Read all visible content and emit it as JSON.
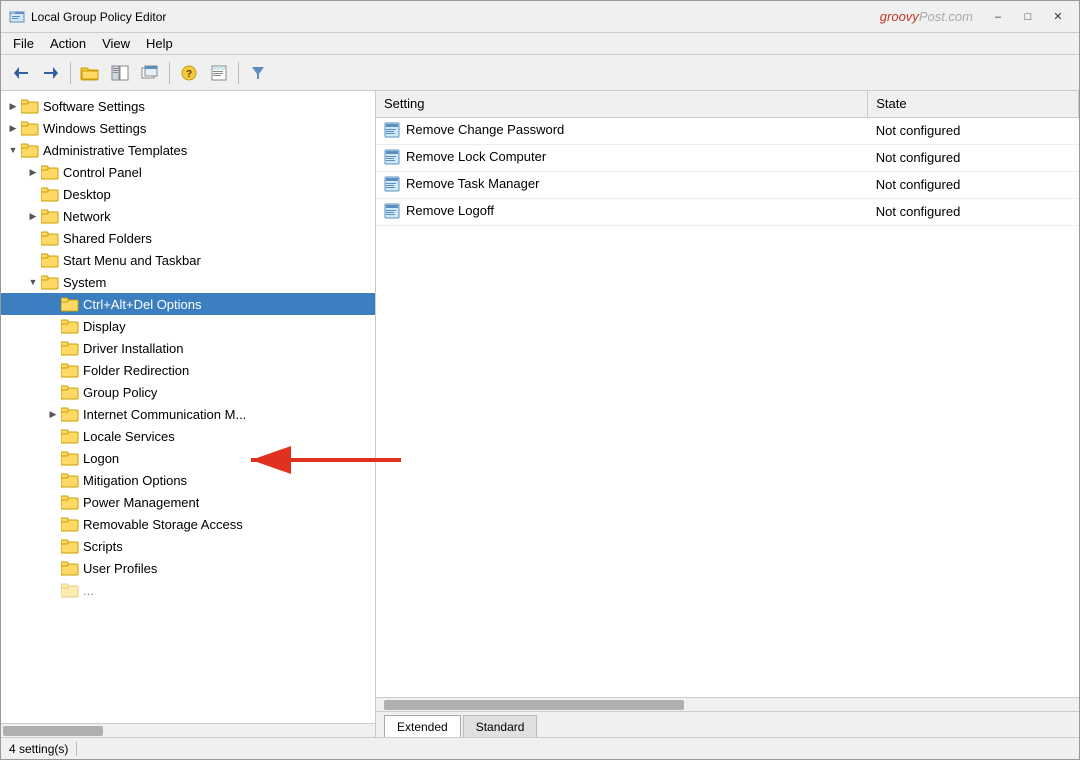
{
  "window": {
    "title": "Local Group Policy Editor",
    "watermark": "groovyPost.com"
  },
  "menubar": {
    "items": [
      "File",
      "Action",
      "View",
      "Help"
    ]
  },
  "toolbar": {
    "buttons": [
      {
        "name": "back",
        "icon": "◀"
      },
      {
        "name": "forward",
        "icon": "▶"
      },
      {
        "name": "up",
        "icon": "📁"
      },
      {
        "name": "show-hide",
        "icon": "📋"
      },
      {
        "name": "new-window",
        "icon": "🗗"
      },
      {
        "name": "help",
        "icon": "?"
      },
      {
        "name": "export",
        "icon": "📤"
      },
      {
        "name": "filter",
        "icon": "⬦"
      }
    ]
  },
  "tree": {
    "nodes": [
      {
        "id": "software-settings",
        "label": "Software Settings",
        "level": 0,
        "expanded": false,
        "hasChildren": true
      },
      {
        "id": "windows-settings",
        "label": "Windows Settings",
        "level": 0,
        "expanded": false,
        "hasChildren": true
      },
      {
        "id": "admin-templates",
        "label": "Administrative Templates",
        "level": 0,
        "expanded": true,
        "hasChildren": true
      },
      {
        "id": "control-panel",
        "label": "Control Panel",
        "level": 1,
        "expanded": false,
        "hasChildren": true
      },
      {
        "id": "desktop",
        "label": "Desktop",
        "level": 1,
        "expanded": false,
        "hasChildren": false
      },
      {
        "id": "network",
        "label": "Network",
        "level": 1,
        "expanded": false,
        "hasChildren": true
      },
      {
        "id": "shared-folders",
        "label": "Shared Folders",
        "level": 1,
        "expanded": false,
        "hasChildren": false
      },
      {
        "id": "start-menu",
        "label": "Start Menu and Taskbar",
        "level": 1,
        "expanded": false,
        "hasChildren": false
      },
      {
        "id": "system",
        "label": "System",
        "level": 1,
        "expanded": true,
        "hasChildren": true
      },
      {
        "id": "ctrl-alt-del",
        "label": "Ctrl+Alt+Del Options",
        "level": 2,
        "expanded": false,
        "hasChildren": false,
        "selected": true
      },
      {
        "id": "display",
        "label": "Display",
        "level": 2,
        "expanded": false,
        "hasChildren": false
      },
      {
        "id": "driver-install",
        "label": "Driver Installation",
        "level": 2,
        "expanded": false,
        "hasChildren": false
      },
      {
        "id": "folder-redirect",
        "label": "Folder Redirection",
        "level": 2,
        "expanded": false,
        "hasChildren": false
      },
      {
        "id": "group-policy",
        "label": "Group Policy",
        "level": 2,
        "expanded": false,
        "hasChildren": false
      },
      {
        "id": "internet-comm",
        "label": "Internet Communication M...",
        "level": 2,
        "expanded": false,
        "hasChildren": true
      },
      {
        "id": "locale-services",
        "label": "Locale Services",
        "level": 2,
        "expanded": false,
        "hasChildren": false
      },
      {
        "id": "logon",
        "label": "Logon",
        "level": 2,
        "expanded": false,
        "hasChildren": false
      },
      {
        "id": "mitigation",
        "label": "Mitigation Options",
        "level": 2,
        "expanded": false,
        "hasChildren": false
      },
      {
        "id": "power-management",
        "label": "Power Management",
        "level": 2,
        "expanded": false,
        "hasChildren": false
      },
      {
        "id": "removable-storage",
        "label": "Removable Storage Access",
        "level": 2,
        "expanded": false,
        "hasChildren": false
      },
      {
        "id": "scripts",
        "label": "Scripts",
        "level": 2,
        "expanded": false,
        "hasChildren": false
      },
      {
        "id": "user-profiles",
        "label": "User Profiles",
        "level": 2,
        "expanded": false,
        "hasChildren": false
      }
    ]
  },
  "table": {
    "columns": [
      {
        "id": "setting",
        "label": "Setting"
      },
      {
        "id": "state",
        "label": "State"
      }
    ],
    "rows": [
      {
        "setting": "Remove Change Password",
        "state": "Not configured"
      },
      {
        "setting": "Remove Lock Computer",
        "state": "Not configured"
      },
      {
        "setting": "Remove Task Manager",
        "state": "Not configured"
      },
      {
        "setting": "Remove Logoff",
        "state": "Not configured"
      }
    ]
  },
  "tabs": [
    {
      "id": "extended",
      "label": "Extended",
      "active": true
    },
    {
      "id": "standard",
      "label": "Standard",
      "active": false
    }
  ],
  "statusbar": {
    "text": "4 setting(s)"
  }
}
